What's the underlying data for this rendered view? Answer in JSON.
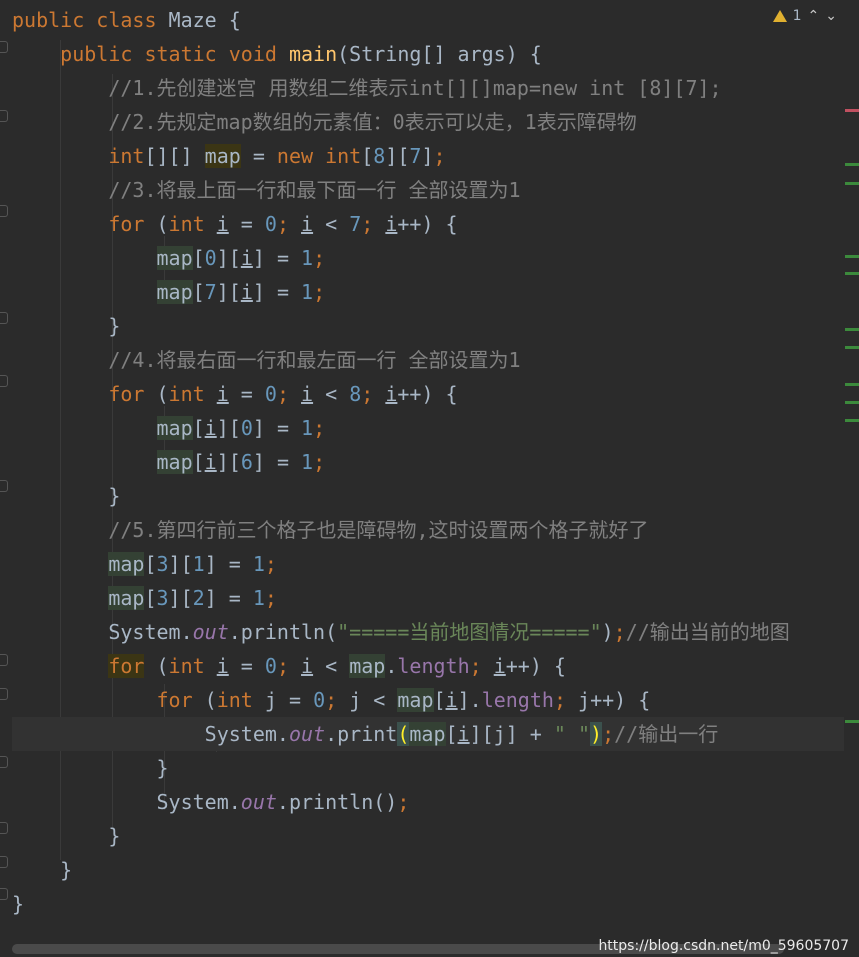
{
  "editor": {
    "warning_count": "1",
    "up_icon": "chevron-up-icon",
    "down_icon": "chevron-down-icon",
    "lines": [
      [
        [
          "kw",
          "public "
        ],
        [
          "kw",
          "class "
        ],
        [
          "",
          "Maze {"
        ]
      ],
      [
        [
          "",
          "    "
        ],
        [
          "kw",
          "public static void "
        ],
        [
          "fn",
          "main"
        ],
        [
          "",
          "(String[] args) {"
        ]
      ],
      [
        [
          "",
          "        "
        ],
        [
          "cm",
          "//1.先创建迷宫 用数组二维表示int[][]map=new int [8][7];"
        ]
      ],
      [
        [
          "",
          "        "
        ],
        [
          "cm",
          "//2.先规定map数组的元素值：0表示可以走，1表示障碍物"
        ]
      ],
      [
        [
          "",
          "        "
        ],
        [
          "kw",
          "int"
        ],
        [
          "",
          "[][] "
        ],
        [
          "hl2",
          "map"
        ],
        [
          "",
          " = "
        ],
        [
          "kw",
          "new int"
        ],
        [
          "",
          "["
        ],
        [
          "num",
          "8"
        ],
        [
          "",
          "]["
        ],
        [
          "num",
          "7"
        ],
        [
          "",
          "]"
        ],
        [
          "kw",
          ";"
        ]
      ],
      [
        [
          "",
          "        "
        ],
        [
          "cm",
          "//3.将最上面一行和最下面一行 全部设置为1"
        ]
      ],
      [
        [
          "",
          "        "
        ],
        [
          "kw",
          "for "
        ],
        [
          "",
          "("
        ],
        [
          "kw",
          "int "
        ],
        [
          "ul",
          "i"
        ],
        [
          "",
          " = "
        ],
        [
          "num",
          "0"
        ],
        [
          "kw",
          "; "
        ],
        [
          "ul",
          "i"
        ],
        [
          "",
          " < "
        ],
        [
          "num",
          "7"
        ],
        [
          "kw",
          "; "
        ],
        [
          "ul",
          "i"
        ],
        [
          "",
          "++) {"
        ]
      ],
      [
        [
          "",
          "            "
        ],
        [
          "hl",
          "map"
        ],
        [
          "",
          "["
        ],
        [
          "num",
          "0"
        ],
        [
          "",
          "]["
        ],
        [
          "ul",
          "i"
        ],
        [
          "",
          "] = "
        ],
        [
          "num",
          "1"
        ],
        [
          "kw",
          ";"
        ]
      ],
      [
        [
          "",
          "            "
        ],
        [
          "hl",
          "map"
        ],
        [
          "",
          "["
        ],
        [
          "num",
          "7"
        ],
        [
          "",
          "]["
        ],
        [
          "ul",
          "i"
        ],
        [
          "",
          "] = "
        ],
        [
          "num",
          "1"
        ],
        [
          "kw",
          ";"
        ]
      ],
      [
        [
          "",
          "        }"
        ]
      ],
      [
        [
          "",
          "        "
        ],
        [
          "cm",
          "//4.将最右面一行和最左面一行 全部设置为1"
        ]
      ],
      [
        [
          "",
          "        "
        ],
        [
          "kw",
          "for "
        ],
        [
          "",
          "("
        ],
        [
          "kw",
          "int "
        ],
        [
          "ul",
          "i"
        ],
        [
          "",
          " = "
        ],
        [
          "num",
          "0"
        ],
        [
          "kw",
          "; "
        ],
        [
          "ul",
          "i"
        ],
        [
          "",
          " < "
        ],
        [
          "num",
          "8"
        ],
        [
          "kw",
          "; "
        ],
        [
          "ul",
          "i"
        ],
        [
          "",
          "++) {"
        ]
      ],
      [
        [
          "",
          "            "
        ],
        [
          "hl",
          "map"
        ],
        [
          "",
          "["
        ],
        [
          "ul",
          "i"
        ],
        [
          "",
          "]["
        ],
        [
          "num",
          "0"
        ],
        [
          "",
          "] = "
        ],
        [
          "num",
          "1"
        ],
        [
          "kw",
          ";"
        ]
      ],
      [
        [
          "",
          "            "
        ],
        [
          "hl",
          "map"
        ],
        [
          "",
          "["
        ],
        [
          "ul",
          "i"
        ],
        [
          "",
          "]["
        ],
        [
          "num",
          "6"
        ],
        [
          "",
          "] = "
        ],
        [
          "num",
          "1"
        ],
        [
          "kw",
          ";"
        ]
      ],
      [
        [
          "",
          "        }"
        ]
      ],
      [
        [
          "",
          "        "
        ],
        [
          "cm",
          "//5.第四行前三个格子也是障碍物,这时设置两个格子就好了"
        ]
      ],
      [
        [
          "",
          "        "
        ],
        [
          "hl",
          "map"
        ],
        [
          "",
          "["
        ],
        [
          "num",
          "3"
        ],
        [
          "",
          "]["
        ],
        [
          "num",
          "1"
        ],
        [
          "",
          "] = "
        ],
        [
          "num",
          "1"
        ],
        [
          "kw",
          ";"
        ]
      ],
      [
        [
          "",
          "        "
        ],
        [
          "hl",
          "map"
        ],
        [
          "",
          "["
        ],
        [
          "num",
          "3"
        ],
        [
          "",
          "]["
        ],
        [
          "num",
          "2"
        ],
        [
          "",
          "] = "
        ],
        [
          "num",
          "1"
        ],
        [
          "kw",
          ";"
        ]
      ],
      [
        [
          "",
          "        System."
        ],
        [
          "st",
          "out"
        ],
        [
          "",
          ".println("
        ],
        [
          "str",
          "\"=====当前地图情况=====\""
        ],
        [
          "",
          ")"
        ],
        [
          "kw",
          ";"
        ],
        [
          "cm",
          "//输出当前的地图"
        ]
      ],
      [
        [
          "",
          "        "
        ],
        [
          "kw hl2",
          "for"
        ],
        [
          "",
          " ("
        ],
        [
          "kw",
          "int "
        ],
        [
          "ul",
          "i"
        ],
        [
          "",
          " = "
        ],
        [
          "num",
          "0"
        ],
        [
          "kw",
          "; "
        ],
        [
          "ul",
          "i"
        ],
        [
          "",
          " < "
        ],
        [
          "hl",
          "map"
        ],
        [
          "",
          "."
        ],
        [
          "fld",
          "length"
        ],
        [
          "kw",
          "; "
        ],
        [
          "ul",
          "i"
        ],
        [
          "",
          "++) {"
        ]
      ],
      [
        [
          "",
          "            "
        ],
        [
          "kw",
          "for "
        ],
        [
          "",
          "("
        ],
        [
          "kw",
          "int "
        ],
        [
          "",
          "j = "
        ],
        [
          "num",
          "0"
        ],
        [
          "kw",
          "; "
        ],
        [
          "",
          "j < "
        ],
        [
          "hl",
          "map"
        ],
        [
          "",
          "["
        ],
        [
          "ul",
          "i"
        ],
        [
          "",
          "]."
        ],
        [
          "fld",
          "length"
        ],
        [
          "kw",
          "; "
        ],
        [
          "",
          "j++) {"
        ]
      ],
      [
        [
          "",
          "                System."
        ],
        [
          "st",
          "out"
        ],
        [
          "",
          ".print"
        ],
        [
          "brace-hl",
          "("
        ],
        [
          "hl",
          "map"
        ],
        [
          "",
          "["
        ],
        [
          "ul",
          "i"
        ],
        [
          "",
          "][j] + "
        ],
        [
          "str",
          "\" \""
        ],
        [
          "brace-hl",
          ")"
        ],
        [
          "kw",
          ";"
        ],
        [
          "cm",
          "//输出一行"
        ]
      ],
      [
        [
          "",
          "            }"
        ]
      ],
      [
        [
          "",
          "            System."
        ],
        [
          "st",
          "out"
        ],
        [
          "",
          ".println()"
        ],
        [
          "kw",
          ";"
        ]
      ],
      [
        [
          "",
          "        }"
        ]
      ],
      [
        [
          "",
          "    }"
        ]
      ],
      [
        [
          "",
          "}"
        ]
      ]
    ],
    "current_line": 21
  },
  "watermark": "https://blog.csdn.net/m0_59605707",
  "colors": {
    "background": "#2b2b2b",
    "keyword": "#cc7832",
    "comment": "#808080",
    "number": "#6897bb",
    "string": "#6a8759",
    "method": "#ffc66d",
    "field": "#9876aa"
  }
}
